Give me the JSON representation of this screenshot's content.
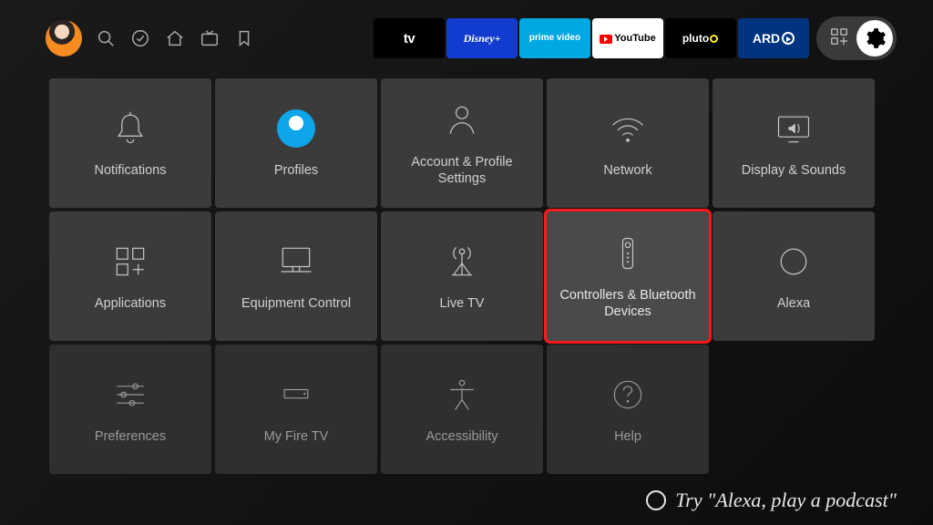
{
  "topbar": {
    "apps": [
      {
        "id": "apple-tv",
        "label": "tv"
      },
      {
        "id": "disney",
        "label": "Disney+"
      },
      {
        "id": "prime",
        "label": "prime video"
      },
      {
        "id": "youtube",
        "label": "YouTube"
      },
      {
        "id": "pluto",
        "label": "pluto tv"
      },
      {
        "id": "ard",
        "label": "ARD"
      }
    ]
  },
  "settings": {
    "tiles": [
      {
        "id": "notifications",
        "label": "Notifications"
      },
      {
        "id": "profiles",
        "label": "Profiles"
      },
      {
        "id": "account",
        "label": "Account & Profile Settings"
      },
      {
        "id": "network",
        "label": "Network"
      },
      {
        "id": "display",
        "label": "Display & Sounds"
      },
      {
        "id": "applications",
        "label": "Applications"
      },
      {
        "id": "equipment",
        "label": "Equipment Control"
      },
      {
        "id": "livetv",
        "label": "Live TV"
      },
      {
        "id": "controllers",
        "label": "Controllers & Bluetooth Devices"
      },
      {
        "id": "alexa",
        "label": "Alexa"
      },
      {
        "id": "preferences",
        "label": "Preferences"
      },
      {
        "id": "myfiretv",
        "label": "My Fire TV"
      },
      {
        "id": "accessibility",
        "label": "Accessibility"
      },
      {
        "id": "help",
        "label": "Help"
      }
    ],
    "highlighted": "controllers"
  },
  "alexa_hint": "Try \"Alexa, play a podcast\""
}
